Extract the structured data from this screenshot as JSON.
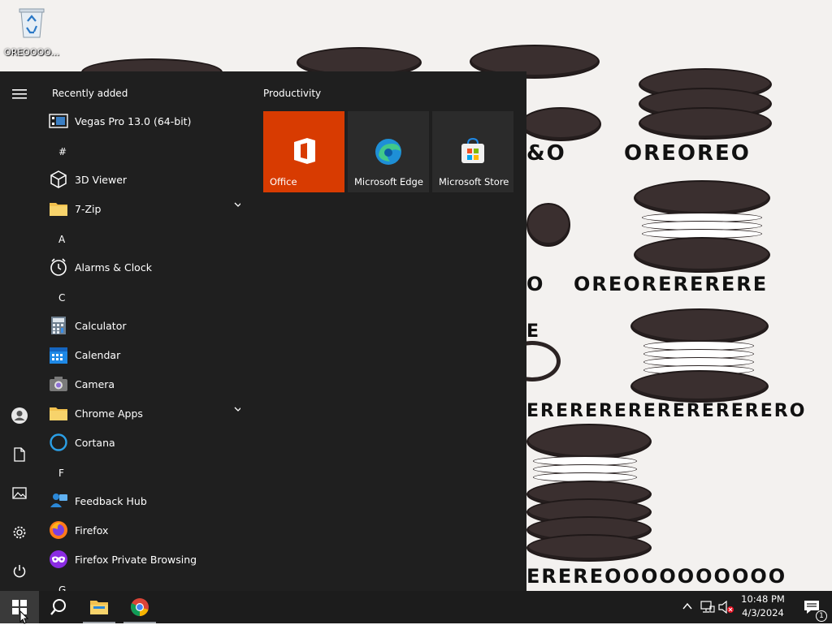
{
  "desktop": {
    "recycle_bin_label": "OREOOOO...",
    "wallpaper_words": [
      "&O",
      "OREOREO",
      "O",
      "OREORERERERE",
      "E",
      "ERERERERERERERERERO",
      "EREREOOOOOOOOOO"
    ]
  },
  "start_menu": {
    "recently_added_label": "Recently added",
    "recent_app": "Vegas Pro 13.0 (64-bit)",
    "groups": [
      {
        "letter": "#",
        "apps": [
          "3D Viewer",
          "7-Zip"
        ]
      },
      {
        "letter": "A",
        "apps": [
          "Alarms & Clock"
        ]
      },
      {
        "letter": "C",
        "apps": [
          "Calculator",
          "Calendar",
          "Camera",
          "Chrome Apps",
          "Cortana"
        ]
      },
      {
        "letter": "F",
        "apps": [
          "Feedback Hub",
          "Firefox",
          "Firefox Private Browsing"
        ]
      },
      {
        "letter": "G",
        "apps": []
      }
    ],
    "tiles_group_title": "Productivity",
    "tiles": [
      {
        "label": "Office",
        "color": "#d83b01"
      },
      {
        "label": "Microsoft Edge",
        "color": "#2b2b2b"
      },
      {
        "label": "Microsoft Store",
        "color": "#2b2b2b"
      }
    ],
    "rail_icons": [
      "hamburger-icon",
      "user-icon",
      "document-icon",
      "pictures-icon",
      "settings-icon",
      "power-icon"
    ]
  },
  "taskbar": {
    "pinned": [
      "start-button",
      "search-button",
      "file-explorer",
      "chrome"
    ],
    "time": "10:48 PM",
    "date": "4/3/2024",
    "notification_count": "1"
  },
  "colors": {
    "start_bg": "#1f1f1f",
    "taskbar_bg": "#1c1c1c",
    "office_tile": "#d83b01",
    "folder": "#f2c14e"
  }
}
